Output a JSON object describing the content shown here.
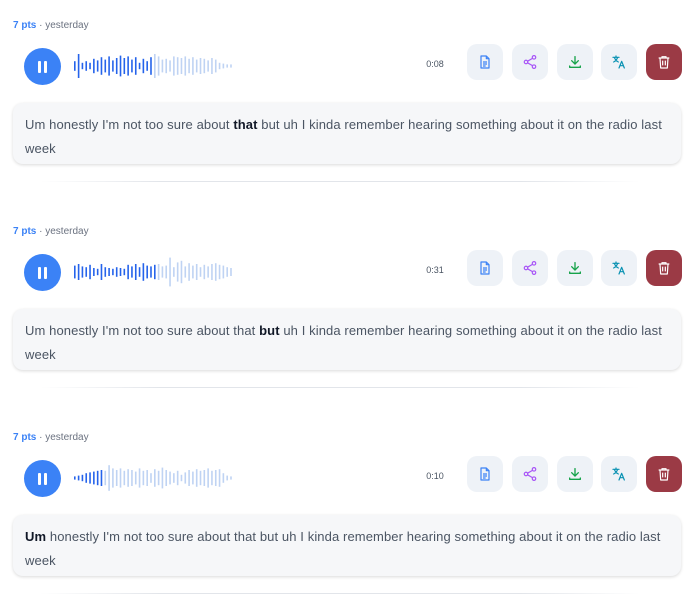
{
  "entries": [
    {
      "points": "7 pts",
      "separator": "·",
      "time": "yesterday",
      "duration": "0:08",
      "progress": 0.5,
      "bold_word": "that",
      "text_before": "Um honestly I'm not too sure about ",
      "text_after": " but uh I kinda remember hearing something about it on the radio last week",
      "wave_amps": [
        0.3,
        0.75,
        0.2,
        0.3,
        0.2,
        0.45,
        0.35,
        0.55,
        0.4,
        0.6,
        0.35,
        0.5,
        0.65,
        0.5,
        0.6,
        0.4,
        0.55,
        0.2,
        0.45,
        0.3,
        0.55,
        0.75,
        0.6,
        0.4,
        0.45,
        0.35,
        0.6,
        0.55,
        0.5,
        0.6,
        0.45,
        0.55,
        0.4,
        0.5,
        0.45,
        0.35,
        0.5,
        0.4,
        0.2,
        0.15,
        0.1,
        0.1
      ]
    },
    {
      "points": "7 pts",
      "separator": "·",
      "time": "yesterday",
      "duration": "0:31",
      "progress": 0.52,
      "bold_word": "but",
      "text_before": "Um honestly I'm not too sure about that ",
      "text_after": " uh I kinda remember hearing something about it on the radio last week",
      "wave_amps": [
        0.4,
        0.5,
        0.35,
        0.3,
        0.45,
        0.25,
        0.2,
        0.5,
        0.3,
        0.25,
        0.2,
        0.3,
        0.25,
        0.2,
        0.45,
        0.35,
        0.5,
        0.3,
        0.55,
        0.4,
        0.35,
        0.45,
        0.5,
        0.35,
        0.4,
        0.9,
        0.3,
        0.6,
        0.7,
        0.35,
        0.55,
        0.4,
        0.5,
        0.3,
        0.45,
        0.35,
        0.5,
        0.55,
        0.45,
        0.4,
        0.3,
        0.25
      ]
    },
    {
      "points": "7 pts",
      "separator": "·",
      "time": "yesterday",
      "duration": "0:10",
      "progress": 0.2,
      "bold_word": "Um",
      "text_before": "",
      "text_after": " honestly I'm not too sure about that but uh I kinda remember hearing something about it on the radio last week",
      "wave_amps": [
        0.1,
        0.15,
        0.2,
        0.3,
        0.35,
        0.4,
        0.45,
        0.5,
        0.45,
        0.8,
        0.6,
        0.5,
        0.6,
        0.45,
        0.55,
        0.5,
        0.4,
        0.6,
        0.45,
        0.5,
        0.3,
        0.55,
        0.45,
        0.65,
        0.5,
        0.4,
        0.3,
        0.45,
        0.2,
        0.35,
        0.5,
        0.4,
        0.55,
        0.45,
        0.5,
        0.6,
        0.45,
        0.5,
        0.55,
        0.3,
        0.15,
        0.1
      ]
    }
  ],
  "actions": [
    {
      "name": "transcript-button",
      "icon": "document-icon",
      "color": "#3b82f6"
    },
    {
      "name": "share-button",
      "icon": "share-icon",
      "color": "#a855f7"
    },
    {
      "name": "download-button",
      "icon": "download-icon",
      "color": "#16a34a"
    },
    {
      "name": "translate-button",
      "icon": "translate-icon",
      "color": "#0891b2"
    },
    {
      "name": "delete-button",
      "icon": "trash-icon",
      "color": "#ffffff"
    }
  ],
  "colors": {
    "accent": "#3b82f6",
    "wave_played": "#2563eb",
    "wave_unplayed": "#bfd3f3",
    "delete_bg": "#9b3a45",
    "action_bg": "#eef2f7"
  }
}
